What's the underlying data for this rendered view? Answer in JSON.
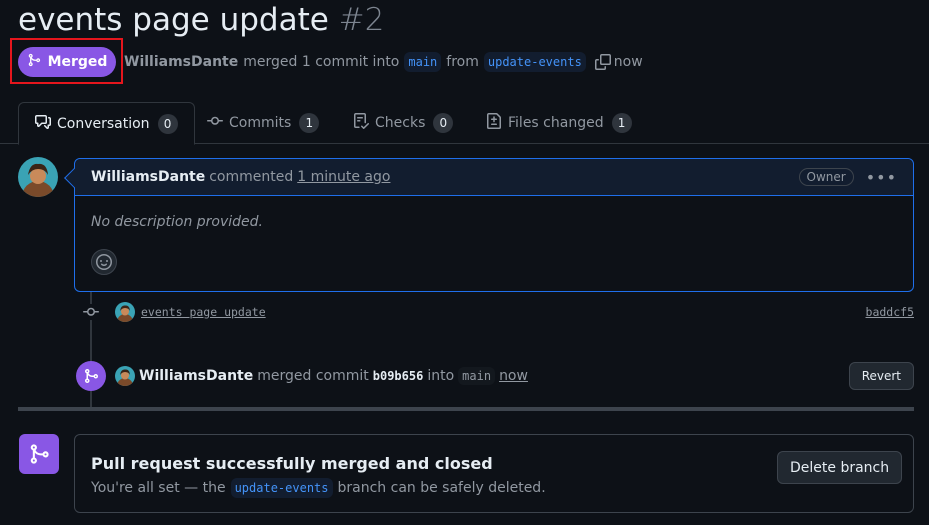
{
  "pr": {
    "title": "events page update",
    "number": "#2",
    "state": "Merged",
    "author": "WilliamsDante",
    "merged_text": "merged 1 commit into",
    "base_branch": "main",
    "from_text": "from",
    "head_branch": "update-events",
    "time": "now"
  },
  "tabs": [
    {
      "label": "Conversation",
      "count": "0",
      "icon": "comment-discussion-icon"
    },
    {
      "label": "Commits",
      "count": "1",
      "icon": "git-commit-icon"
    },
    {
      "label": "Checks",
      "count": "0",
      "icon": "checklist-icon"
    },
    {
      "label": "Files changed",
      "count": "1",
      "icon": "file-diff-icon"
    }
  ],
  "comment": {
    "author": "WilliamsDante",
    "action": "commented",
    "time": "1 minute ago",
    "role": "Owner",
    "body": "No description provided."
  },
  "commit": {
    "message": "events page update",
    "sha": "baddcf5"
  },
  "merge_event": {
    "author": "WilliamsDante",
    "action": "merged commit",
    "sha": "b09b656",
    "into": "into",
    "branch": "main",
    "time": "now",
    "revert_label": "Revert"
  },
  "merge_box": {
    "heading": "Pull request successfully merged and closed",
    "sub_before": "You're all set — the",
    "branch": "update-events",
    "sub_after": "branch can be safely deleted.",
    "delete_label": "Delete branch"
  },
  "colors": {
    "merged": "#8957e5",
    "background": "#0d1117",
    "accent_border": "#1f6feb",
    "highlight": "#e5161d"
  }
}
